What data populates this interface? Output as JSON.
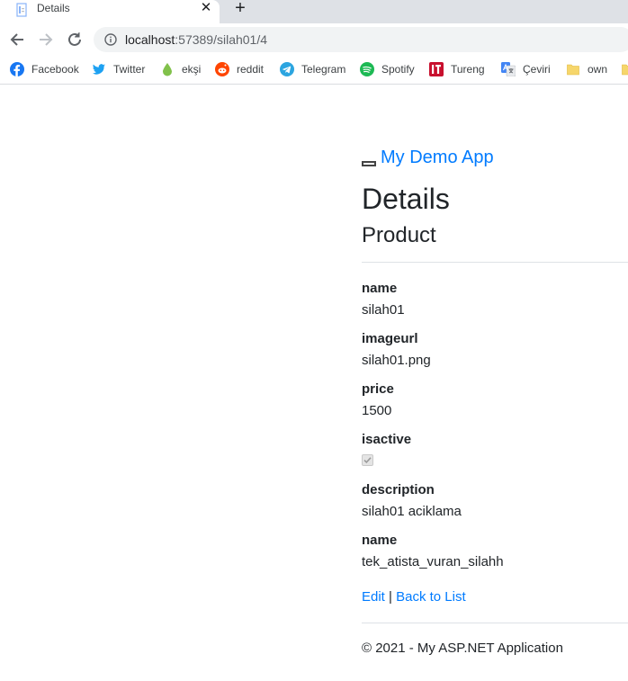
{
  "browser": {
    "tab_title": "Details",
    "tab_close_glyph": "✕",
    "newtab_glyph": "+",
    "url_host": "localhost",
    "url_rest": ":57389/silah01/4",
    "bookmarks": [
      {
        "label": "Facebook",
        "icon": "facebook-icon",
        "color": "#1877f2"
      },
      {
        "label": "Twitter",
        "icon": "twitter-icon",
        "color": "#1da1f2"
      },
      {
        "label": "ekşi",
        "icon": "eksi-icon",
        "color": "#81c14b"
      },
      {
        "label": "reddit",
        "icon": "reddit-icon",
        "color": "#ff4500"
      },
      {
        "label": "Telegram",
        "icon": "telegram-icon",
        "color": "#2ca5e0"
      },
      {
        "label": "Spotify",
        "icon": "spotify-icon",
        "color": "#1db954"
      },
      {
        "label": "Tureng",
        "icon": "tureng-icon",
        "color": "#c8102e"
      },
      {
        "label": "Çeviri",
        "icon": "translate-icon",
        "color": "#4285f4"
      },
      {
        "label": "own",
        "icon": "folder-icon",
        "color": "#f6d66b"
      }
    ]
  },
  "page": {
    "brand": "My Demo App",
    "title": "Details",
    "subtitle": "Product",
    "fields": [
      {
        "label": "name",
        "value": "silah01"
      },
      {
        "label": "imageurl",
        "value": "silah01.png"
      },
      {
        "label": "price",
        "value": "1500"
      },
      {
        "label": "isactive",
        "checked": true
      },
      {
        "label": "description",
        "value": "silah01 aciklama"
      },
      {
        "label": "name",
        "value": "tek_atista_vuran_silahh"
      }
    ],
    "edit_link": "Edit",
    "separator": "|",
    "back_link": "Back to List",
    "footer": "© 2021 - My ASP.NET Application"
  },
  "colors": {
    "link": "#007bff",
    "text": "#212529",
    "rule": "#dee2e6"
  }
}
